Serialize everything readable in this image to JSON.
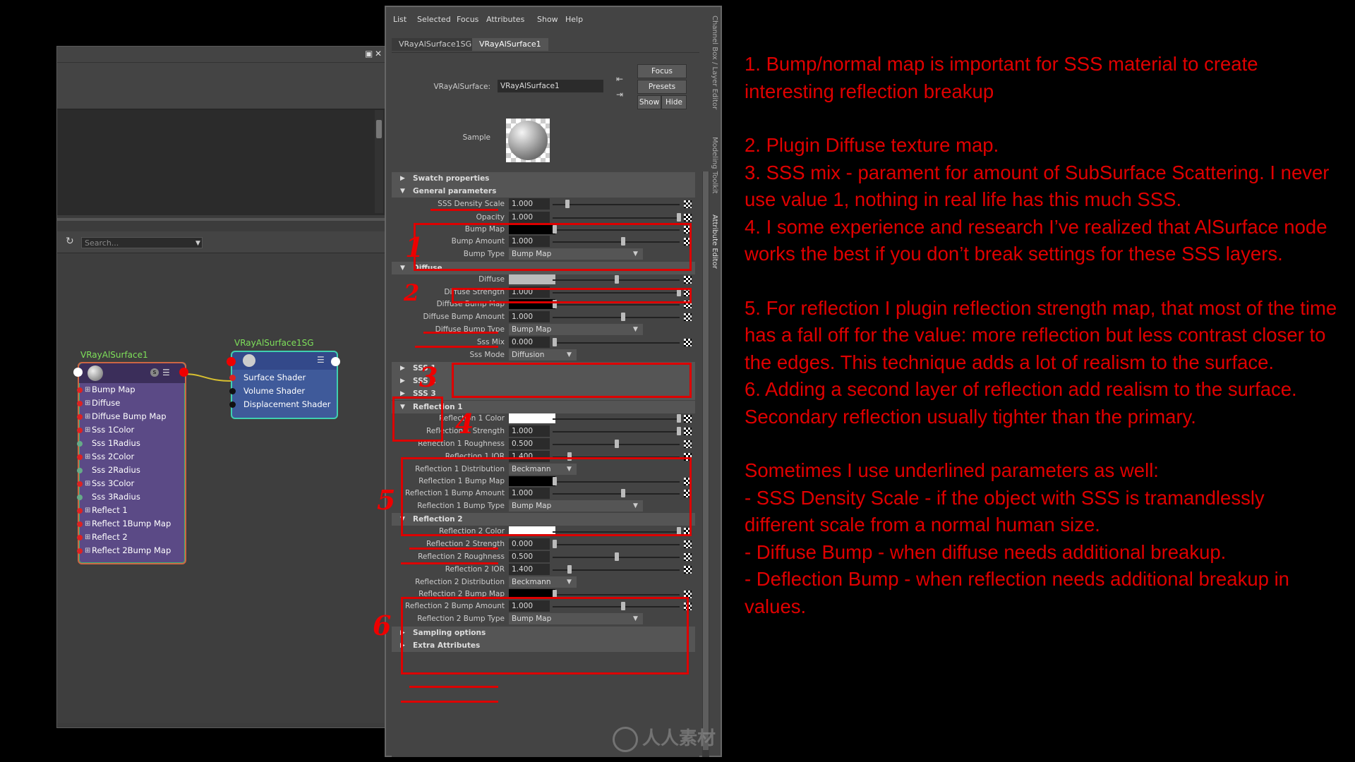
{
  "hypershade": {
    "search_placeholder": "Search...",
    "node_shader": {
      "title": "VRayAlSurface1",
      "ports": [
        "Bump Map",
        "Diffuse",
        "Diffuse Bump Map",
        "Sss 1Color",
        "Sss 1Radius",
        "Sss 2Color",
        "Sss 2Radius",
        "Sss 3Color",
        "Sss 3Radius",
        "Reflect 1",
        "Reflect 1Bump Map",
        "Reflect 2",
        "Reflect 2Bump Map"
      ]
    },
    "node_sg": {
      "title": "VRayAlSurface1SG",
      "ports": [
        "Surface Shader",
        "Volume Shader",
        "Displacement Shader"
      ]
    }
  },
  "attribute_editor": {
    "menu": [
      "List",
      "Selected",
      "Focus",
      "Attributes",
      "Show",
      "Help"
    ],
    "tabs": [
      "VRayAlSurface1SG",
      "VRayAlSurface1"
    ],
    "node_type_label": "VRayAlSurface:",
    "node_name": "VRayAlSurface1",
    "buttons": {
      "focus": "Focus",
      "presets": "Presets",
      "show": "Show",
      "hide": "Hide"
    },
    "sample_label": "Sample",
    "sections": {
      "swatch": "Swatch properties",
      "general": "General parameters",
      "diffuse": "Diffuse",
      "sss1": "SSS 1",
      "sss2": "SSS 2",
      "sss3": "SSS 3",
      "refl1": "Reflection 1",
      "refl2": "Reflection 2",
      "sampling": "Sampling options",
      "extra": "Extra Attributes"
    },
    "general": {
      "sss_density_label": "SSS Density Scale",
      "sss_density": "1.000",
      "opacity_label": "Opacity",
      "opacity": "1.000",
      "bump_map_label": "Bump Map",
      "bump_amount_label": "Bump Amount",
      "bump_amount": "1.000",
      "bump_type_label": "Bump Type",
      "bump_type": "Bump Map"
    },
    "diffuse": {
      "diffuse_label": "Diffuse",
      "strength_label": "Diffuse Strength",
      "strength": "1.000",
      "bump_map_label": "Diffuse Bump Map",
      "bump_amount_label": "Diffuse Bump Amount",
      "bump_amount": "1.000",
      "bump_type_label": "Diffuse Bump Type",
      "bump_type": "Bump Map",
      "sss_mix_label": "Sss Mix",
      "sss_mix": "0.000",
      "sss_mode_label": "Sss Mode",
      "sss_mode": "Diffusion"
    },
    "refl1": {
      "color_label": "Reflection 1 Color",
      "strength_label": "Reflection 1 Strength",
      "strength": "1.000",
      "roughness_label": "Reflection 1 Roughness",
      "roughness": "0.500",
      "ior_label": "Reflection 1 IOR",
      "ior": "1.400",
      "dist_label": "Reflection 1 Distribution",
      "dist": "Beckmann",
      "bump_map_label": "Reflection 1 Bump Map",
      "bump_amount_label": "Reflection 1 Bump Amount",
      "bump_amount": "1.000",
      "bump_type_label": "Reflection 1 Bump Type",
      "bump_type": "Bump Map"
    },
    "refl2": {
      "color_label": "Reflection 2 Color",
      "strength_label": "Reflection 2 Strength",
      "strength": "0.000",
      "roughness_label": "Reflection 2 Roughness",
      "roughness": "0.500",
      "ior_label": "Reflection 2 IOR",
      "ior": "1.400",
      "dist_label": "Reflection 2 Distribution",
      "dist": "Beckmann",
      "bump_map_label": "Reflection 2 Bump Map",
      "bump_amount_label": "Reflection 2 Bump Amount",
      "bump_amount": "1.000",
      "bump_type_label": "Reflection 2 Bump Type",
      "bump_type": "Bump Map"
    },
    "side_tabs": [
      "Channel Box / Layer Editor",
      "Modeling Toolkit",
      "Attribute Editor"
    ]
  },
  "annotations": {
    "numbers": [
      "1",
      "2",
      "3",
      "4",
      "5",
      "6"
    ],
    "notes": [
      "1. Bump/normal map is important for SSS material to create interesting reflection breakup",
      "2. Plugin Diffuse texture map.",
      "3. SSS mix - parament for amount of SubSurface Scattering. I never use value 1, nothing in real life has this much SSS.",
      "4. I some experience and research I’ve realized that AlSurface node works the best if you don’t break settings for these SSS layers.",
      "5. For reflection I plugin reflection strength map, that most of the time has a fall off for the value: more reflection but less contrast closer to the edges. This technique adds a lot of realism to the surface.",
      "6. Adding a second layer of reflection add realism to the surface. Secondary reflection usually tighter than the primary.",
      "Sometimes I use underlined parameters as well:",
      "- SSS Density Scale - if the object with SSS is tramandlessly different scale from a normal human size.",
      "- Diffuse Bump - when diffuse needs additional breakup.",
      "- Deflection Bump - when reflection needs additional breakup in values."
    ]
  },
  "watermark": "人人素材",
  "colors": {
    "annotation_red": "#e00000",
    "node_title_green": "#7ee05a"
  }
}
